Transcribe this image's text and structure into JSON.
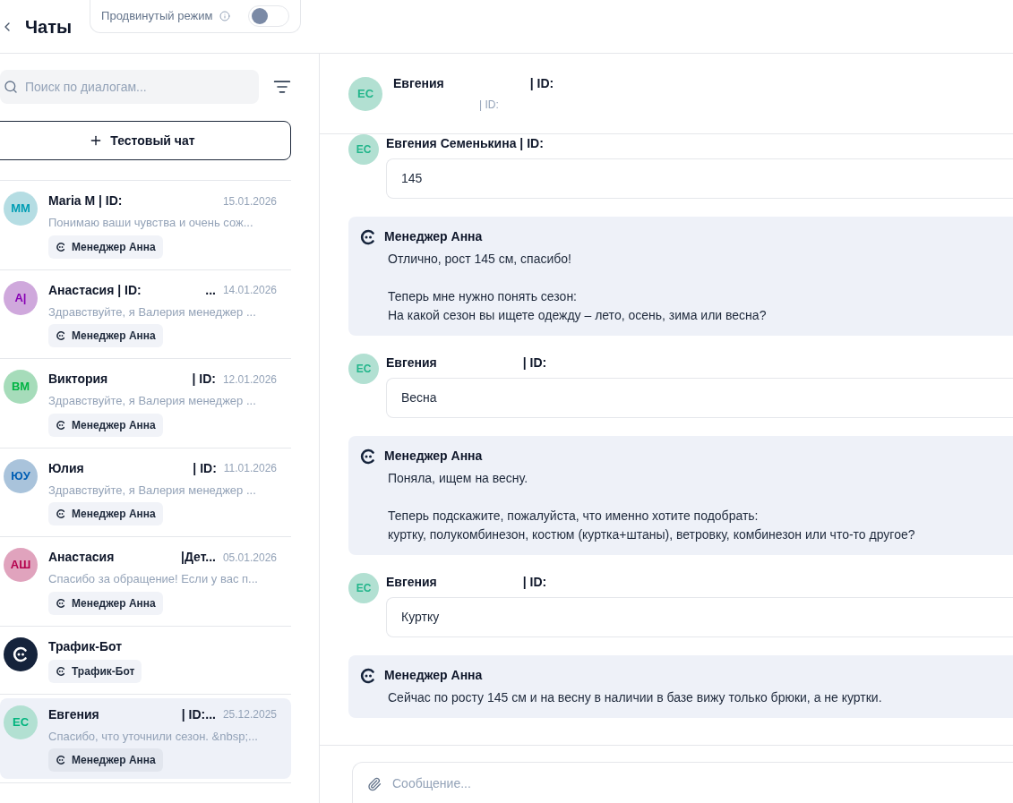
{
  "header": {
    "title": "Чаты",
    "advanced_mode": {
      "label": "Продвинутый режим",
      "on": false
    }
  },
  "sidebar": {
    "search": {
      "placeholder": "Поиск по диалогам..."
    },
    "test_chat_button": "Тестовый чат",
    "items": [
      {
        "kind": "user",
        "initials": "ММ",
        "color": "#b5dde3",
        "name": "Maria M | ID:",
        "date": "15.01.2026",
        "preview": "Понимаю ваши чувства и очень сож...",
        "agent": "Менеджер Анна",
        "selected": false
      },
      {
        "kind": "user",
        "initials": "А|",
        "color": "#cfa8dc",
        "name": "Анастасия | ID:",
        "id_tag": "...",
        "date": "14.01.2026",
        "preview": "Здравствуйте, я Валерия менеджер ...",
        "agent": "Менеджер Анна",
        "selected": false
      },
      {
        "kind": "user",
        "initials": "ВМ",
        "color": "#a6dcba",
        "name": "Виктория",
        "id_tag": "| ID:",
        "date": "12.01.2026",
        "preview": "Здравствуйте, я Валерия менеджер ...",
        "agent": "Менеджер Анна",
        "selected": false
      },
      {
        "kind": "user",
        "initials": "ЮУ",
        "color": "#a9c3db",
        "name": "Юлия",
        "id_tag": "| ID:",
        "date": "11.01.2026",
        "preview": "Здравствуйте, я Валерия менеджер ...",
        "agent": "Менеджер Анна",
        "selected": false
      },
      {
        "kind": "user",
        "initials": "АШ",
        "color": "#e0a3bd",
        "name": "Анастасия",
        "id_tag": "|Дет...",
        "date": "05.01.2026",
        "preview": "Спасибо за обращение! Если у вас п...",
        "agent": "Менеджер Анна",
        "selected": false
      },
      {
        "kind": "bot",
        "name": "Трафик-Бот",
        "agent": "Трафик-Бот",
        "selected": false
      },
      {
        "kind": "user",
        "initials": "ЕС",
        "color": "#b2e0d2",
        "name": "Евгения",
        "id_tag": "| ID:...",
        "date": "25.12.2025",
        "preview": "Спасибо, что уточнили сезон. &nbsp;...",
        "agent": "Менеджер Анна",
        "selected": true
      }
    ]
  },
  "chat": {
    "contact": {
      "initials": "ЕС",
      "name": "Евгения",
      "id_tag": "| ID:",
      "sub_id": "| ID:"
    },
    "messages": [
      {
        "kind": "user",
        "initials": "ЕС",
        "name": "Евгения Семенькина | ID:",
        "text": "145"
      },
      {
        "kind": "manager",
        "name": "Менеджер Анна",
        "paragraphs": [
          [
            "Отлично, рост 145 см, спасибо!"
          ],
          [
            "Теперь мне нужно понять сезон:",
            "На какой сезон вы ищете одежду – лето, осень, зима или весна?"
          ]
        ]
      },
      {
        "kind": "user",
        "initials": "ЕС",
        "name": "Евгения",
        "id_tag": "| ID:",
        "text": "Весна"
      },
      {
        "kind": "manager",
        "name": "Менеджер Анна",
        "paragraphs": [
          [
            "Поняла, ищем на весну."
          ],
          [
            "Теперь подскажите, пожалуйста, что именно хотите подобрать:",
            "куртку, полукомбинезон, костюм (куртка+штаны), ветровку, комбинезон или что-то другое?"
          ]
        ]
      },
      {
        "kind": "user",
        "initials": "ЕС",
        "name": "Евгения",
        "id_tag": "| ID:",
        "text": "Куртку"
      },
      {
        "kind": "manager",
        "name": "Менеджер Анна",
        "paragraphs": [
          [
            "Сейчас по росту 145 см и на весну в наличии в базе вижу только брюки, а не куртки."
          ]
        ]
      }
    ],
    "composer": {
      "placeholder": "Сообщение..."
    }
  }
}
